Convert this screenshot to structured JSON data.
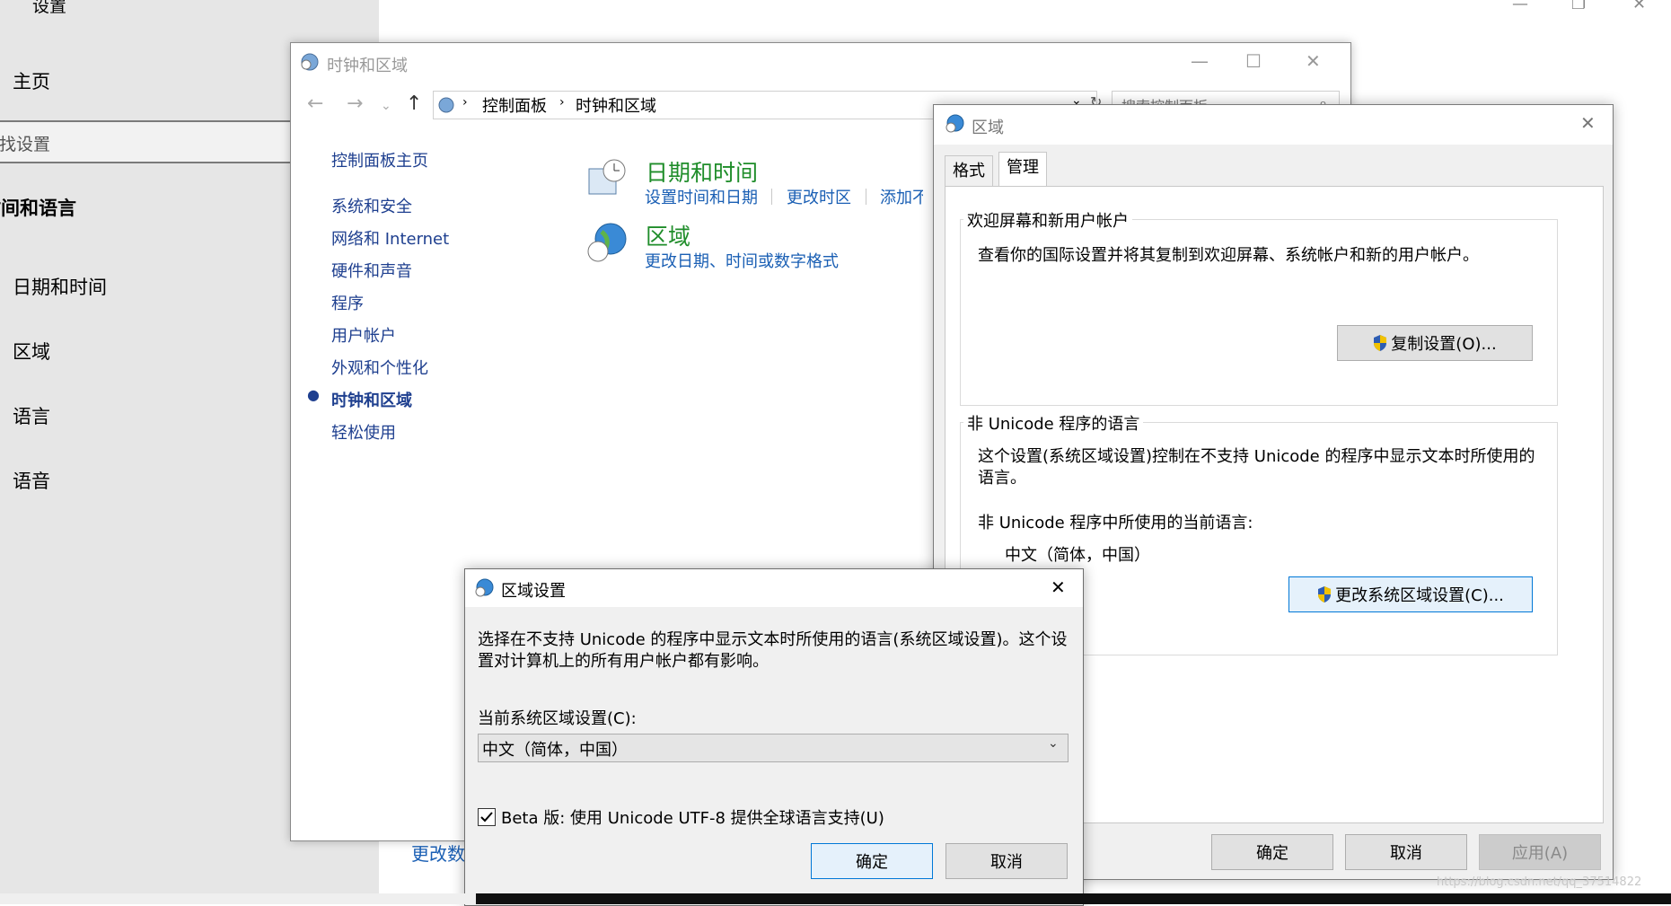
{
  "settings": {
    "title": "设置",
    "home": "主页",
    "search_placeholder": "查找设置",
    "section": "时间和语言",
    "items": [
      "日期和时间",
      "区域",
      "语言",
      "语音"
    ],
    "bottom_link": "更改数据格式"
  },
  "control_panel": {
    "title": "时钟和区域",
    "breadcrumb": [
      "控制面板",
      "时钟和区域"
    ],
    "search_placeholder": "搜索控制面板",
    "nav": [
      "控制面板主页",
      "系统和安全",
      "网络和 Internet",
      "硬件和声音",
      "程序",
      "用户帐户",
      "外观和个性化",
      "时钟和区域",
      "轻松使用"
    ],
    "active_nav": "时钟和区域",
    "sections": [
      {
        "heading": "日期和时间",
        "links": [
          "设置时间和日期",
          "更改时区",
          "添加不同时区的时钟"
        ]
      },
      {
        "heading": "区域",
        "links": [
          "更改日期、时间或数字格式"
        ]
      }
    ]
  },
  "region_dialog": {
    "title": "区域",
    "tabs": [
      "格式",
      "管理"
    ],
    "active_tab": "管理",
    "welcome_group": {
      "title": "欢迎屏幕和新用户帐户",
      "desc": "查看你的国际设置并将其复制到欢迎屏幕、系统帐户和新的用户帐户。",
      "button": "复制设置(O)..."
    },
    "unicode_group": {
      "title": "非 Unicode 程序的语言",
      "desc_line1": "这个设置(系统区域设置)控制在不支持 Unicode 的程序中显示文本时所使用的",
      "desc_line2": "语言。",
      "current_label": "非 Unicode 程序中所使用的当前语言:",
      "current_value": "中文（简体，中国）",
      "button": "更改系统区域设置(C)..."
    },
    "ok": "确定",
    "cancel": "取消",
    "apply": "应用(A)"
  },
  "region_settings_dialog": {
    "title": "区域设置",
    "desc_line1": "选择在不支持 Unicode 的程序中显示文本时所使用的语言(系统区域设置)。这个设",
    "desc_line2": "置对计算机上的所有用户帐户都有影响。",
    "select_label": "当前系统区域设置(C):",
    "select_value": "中文（简体，中国）",
    "checkbox_label": "Beta 版: 使用 Unicode UTF-8 提供全球语言支持(U)",
    "checkbox_checked": true,
    "ok": "确定",
    "cancel": "取消"
  },
  "watermark": "https://blog.csdn.net/qq_37514822",
  "colors": {
    "link_blue": "#1a5fb4",
    "heading_green": "#1f8d2a",
    "accent": "#0078d7"
  }
}
